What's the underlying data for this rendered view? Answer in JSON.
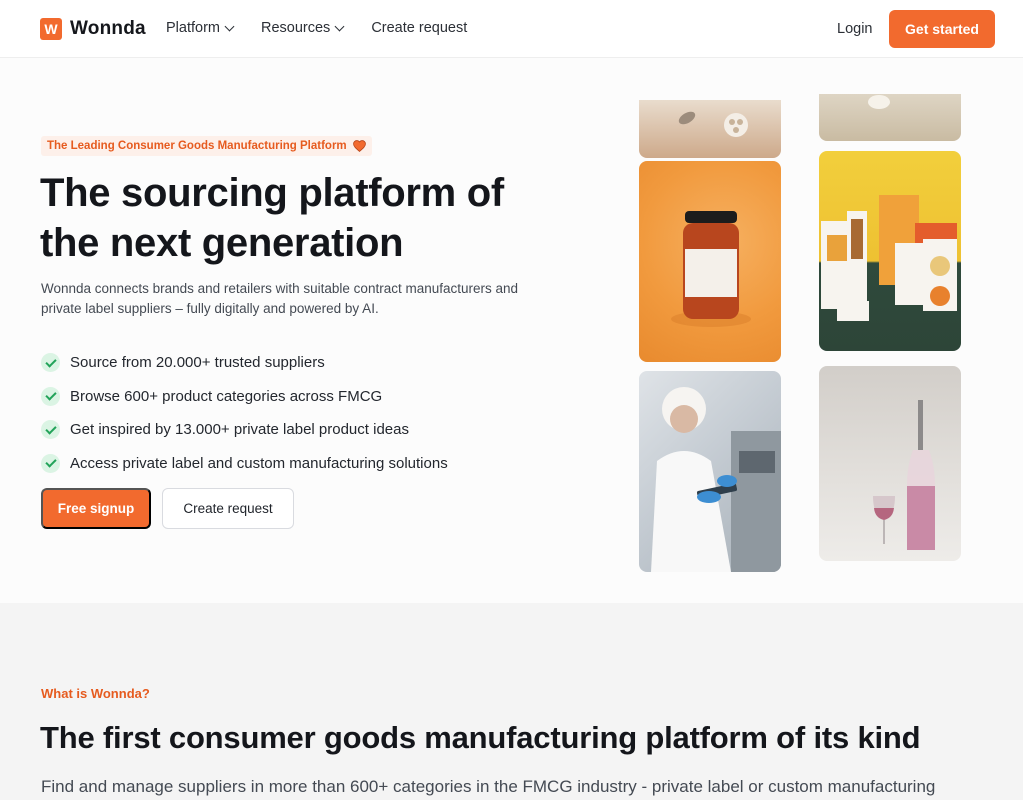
{
  "header": {
    "logo_mark": "W",
    "logo_text": "Wonnda",
    "nav": [
      {
        "label": "Platform"
      },
      {
        "label": "Resources"
      },
      {
        "label": "Create request"
      }
    ],
    "login_label": "Login",
    "cta_label": "Get started"
  },
  "hero": {
    "badge": "The Leading Consumer Goods Manufacturing Platform",
    "title": "The sourcing platform of the next generation",
    "description": "Wonnda connects brands and retailers with suitable contract manufacturers and private label suppliers – fully digitally and powered by AI.",
    "features": [
      "Source from 20.000+ trusted suppliers",
      "Browse 600+ product categories across FMCG",
      "Get inspired by 13.000+ private label product ideas",
      "Access private label and custom manufacturing solutions"
    ],
    "primary_button": "Free signup",
    "secondary_button": "Create request"
  },
  "section2": {
    "eyebrow": "What is Wonnda?",
    "title": "The first consumer goods manufacturing platform of its kind",
    "description": "Find and manage suppliers in more than 600+ categories in the FMCG industry - private label or custom manufacturing"
  },
  "colors": {
    "accent": "#f26a2e",
    "check_bg": "#dbf4e4",
    "check_mark": "#23a35a"
  }
}
